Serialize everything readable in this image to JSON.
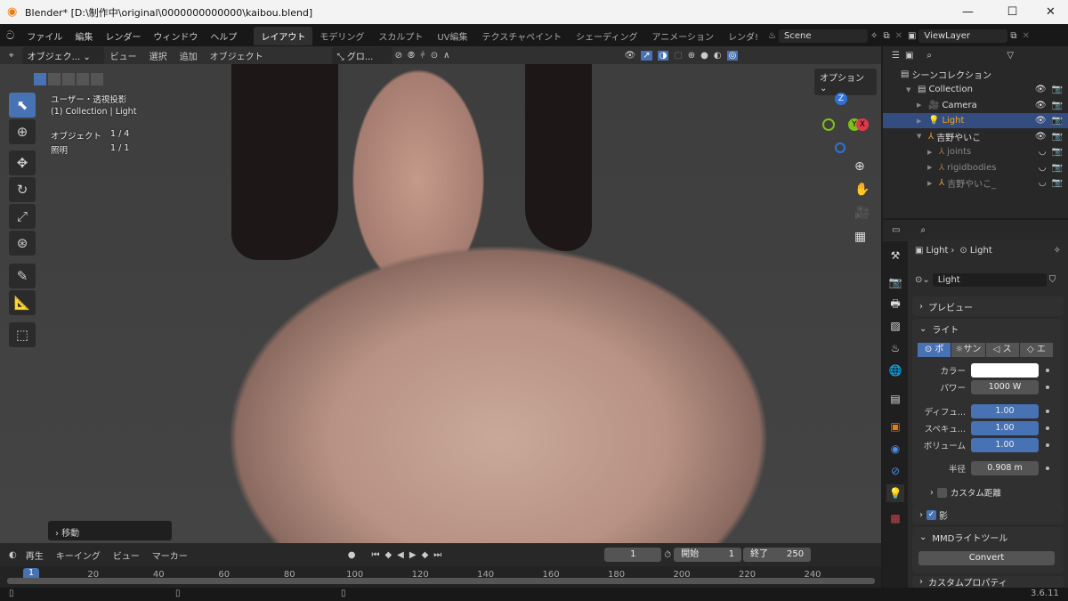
{
  "window": {
    "title": "Blender* [D:\\制作中\\original\\0000000000000\\kaibou.blend]"
  },
  "menu": [
    "ファイル",
    "編集",
    "レンダー",
    "ウィンドウ",
    "ヘルプ"
  ],
  "workspaces": [
    "レイアウト",
    "モデリング",
    "スカルプト",
    "UV編集",
    "テクスチャペイント",
    "シェーディング",
    "アニメーション",
    "レンダ!"
  ],
  "scene": {
    "name": "Scene",
    "view_layer": "ViewLayer"
  },
  "viewport_header": {
    "mode": "オブジェク...",
    "menus": [
      "ビュー",
      "選択",
      "追加",
      "オブジェクト"
    ],
    "transform_orientation": "グロ...",
    "options": "オプション"
  },
  "viewport_overlay": {
    "view_name": "ユーザー・透視投影",
    "collection": "(1) Collection | Light",
    "objects_label": "オブジェクト",
    "objects_value": "1 / 4",
    "lights_label": "照明",
    "lights_value": "1 / 1",
    "last_op": "移動"
  },
  "gizmo": {
    "z": "Z",
    "y": "Y",
    "x": "X"
  },
  "outliner": {
    "scene_collection": "シーンコレクション",
    "rows": [
      {
        "name": "Collection",
        "icon": "collection-icon"
      },
      {
        "name": "Camera",
        "icon": "camera-icon"
      },
      {
        "name": "Light",
        "icon": "light-icon",
        "selected": true
      },
      {
        "name": "吉野やいこ",
        "icon": "armature-icon"
      },
      {
        "name": "joints",
        "icon": "empty-icon"
      },
      {
        "name": "rigidbodies",
        "icon": "empty-icon"
      },
      {
        "name": "吉野やいこ_",
        "icon": "armature-icon"
      }
    ]
  },
  "properties": {
    "breadcrumb": [
      "Light",
      "Light"
    ],
    "datablock": "Light",
    "panels": {
      "preview": "プレビュー",
      "light": "ライト",
      "shadow": "影",
      "mmd": "MMDライトツール",
      "custom_props": "カスタムプロパティ"
    },
    "light_types": [
      "ポ",
      "サン",
      "ス",
      "エ"
    ],
    "color_label": "カラー",
    "color_value": "#ffffff",
    "power_label": "パワー",
    "power_value": "1000 W",
    "diffuse_label": "ディフュ...",
    "diffuse_value": "1.00",
    "specular_label": "スペキュ...",
    "specular_value": "1.00",
    "volume_label": "ボリューム",
    "volume_value": "1.00",
    "radius_label": "半径",
    "radius_value": "0.908 m",
    "custom_distance": "カスタム距離",
    "custom_distance_checked": false,
    "shadow_checked": true,
    "convert": "Convert"
  },
  "timeline": {
    "menus": [
      "再生",
      "キーイング",
      "ビュー",
      "マーカー"
    ],
    "current_frame": "1",
    "start_label": "開始",
    "start": "1",
    "end_label": "終了",
    "end": "250",
    "ticks": [
      "20",
      "40",
      "60",
      "80",
      "100",
      "120",
      "140",
      "160",
      "180",
      "200",
      "220",
      "240"
    ],
    "marker": "1"
  },
  "status": {
    "version": "3.6.11"
  },
  "colors": {
    "accent": "#4772b3",
    "selected_row": "#334d80",
    "light_name": "#f5a623"
  }
}
